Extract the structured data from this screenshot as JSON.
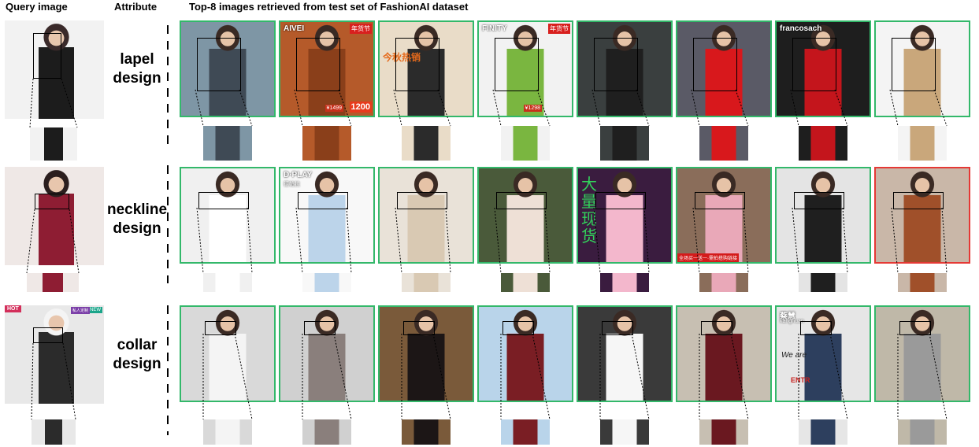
{
  "header": {
    "query": "Query image",
    "attribute": "Attribute",
    "results": "Top-8 images retrieved from test set of FashionAI dataset"
  },
  "rows": [
    {
      "attribute_line1": "lapel",
      "attribute_line2": "design",
      "query_colors": [
        "#f2f2f2",
        "#1c1c1c",
        "#3a2a2a"
      ],
      "results": [
        {
          "bg": "#7e96a5",
          "garment": "#3f4a55",
          "correct": true
        },
        {
          "bg": "#b55a2a",
          "garment": "#8a3f1a",
          "correct": true,
          "top_text": "AIVEI",
          "badge": "年货节",
          "price": "1200",
          "small_price": "¥1499"
        },
        {
          "bg": "#e9dcc8",
          "garment": "#2b2b2b",
          "correct": true,
          "overlay_text": "今秋热销"
        },
        {
          "bg": "#f2f2f2",
          "garment": "#7ab640",
          "correct": true,
          "top_text": "FINITY",
          "badge": "年货节",
          "small_price": "¥1298"
        },
        {
          "bg": "#3a3f3f",
          "garment": "#1f1f1f",
          "correct": true
        },
        {
          "bg": "#5a5a66",
          "garment": "#d8181c",
          "correct": true
        },
        {
          "bg": "#1e1e1e",
          "garment": "#c4151c",
          "correct": true,
          "top_text": "francosach"
        },
        {
          "bg": "#f4f4f4",
          "garment": "#c9a77b",
          "correct": true
        }
      ]
    },
    {
      "attribute_line1": "neckline",
      "attribute_line2": "design",
      "query_colors": [
        "#efe8e6",
        "#8e1d33",
        "#2b1e1e"
      ],
      "results": [
        {
          "bg": "#f0f0f0",
          "garment": "#ffffff",
          "correct": true
        },
        {
          "bg": "#f8f8f8",
          "garment": "#bcd4ea",
          "correct": true,
          "top_text": "D·PLAY",
          "sub_text": "德帕拉"
        },
        {
          "bg": "#e9e2d8",
          "garment": "#d9c9b3",
          "correct": true
        },
        {
          "bg": "#4a5a3a",
          "garment": "#eee0d6",
          "correct": true
        },
        {
          "bg": "#3a1c3f",
          "garment": "#f3b7cc",
          "correct": true,
          "big_text": "大量现货"
        },
        {
          "bg": "#8a6d5a",
          "garment": "#e9a8b8",
          "correct": true,
          "bottom_text": "全场买一送一·需拍搭购链接"
        },
        {
          "bg": "#e4e4e4",
          "garment": "#1f1f1f",
          "correct": true
        },
        {
          "bg": "#c9b7a8",
          "garment": "#a0502a",
          "correct": false
        }
      ]
    },
    {
      "attribute_line1": "collar",
      "attribute_line2": "design",
      "query_colors": [
        "#e8e8e8",
        "#2b2b2b",
        "#f4f4f4"
      ],
      "results": [
        {
          "bg": "#d9d9d9",
          "garment": "#f4f4f4",
          "correct": true
        },
        {
          "bg": "#d0d0d0",
          "garment": "#8a7f7c",
          "correct": true
        },
        {
          "bg": "#7a5a3a",
          "garment": "#1c1616",
          "correct": true
        },
        {
          "bg": "#b9d4ea",
          "garment": "#7a1e24",
          "correct": true
        },
        {
          "bg": "#3a3a3a",
          "garment": "#f6f6f6",
          "correct": true
        },
        {
          "bg": "#c7bfb2",
          "garment": "#6a1820",
          "correct": true
        },
        {
          "bg": "#e6e6e6",
          "garment": "#2d3f5e",
          "correct": true,
          "top_text": "蔡慧",
          "sub_text": "kangnuan",
          "wall_text": "We are",
          "sign_text": "ENTR"
        },
        {
          "bg": "#bfb8a8",
          "garment": "#9a9a9a",
          "correct": true
        }
      ]
    }
  ],
  "query_badges": {
    "hot": "HOT",
    "new": "NEW",
    "tag": "私人定制"
  }
}
